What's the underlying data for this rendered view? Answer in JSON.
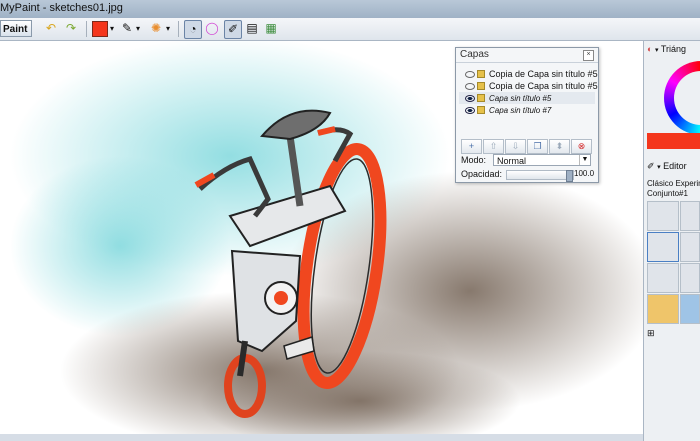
{
  "window": {
    "title": "MyPaint - sketches01.jpg"
  },
  "toolbar": {
    "menu_label": "Paint",
    "colors": {
      "current": "#f4361c",
      "accent": "#e98d2d"
    }
  },
  "layers_panel": {
    "title": "Capas",
    "layers": [
      {
        "name": "Copia de Capa sin título #5",
        "visible": false,
        "italic": false
      },
      {
        "name": "Copia de Capa sin título #5",
        "visible": false,
        "italic": false
      },
      {
        "name": "Capa sin título #5",
        "visible": true,
        "italic": true
      },
      {
        "name": "Capa sin título #7",
        "visible": true,
        "italic": true
      }
    ],
    "buttons": [
      "add-layer-icon",
      "move-up-icon",
      "move-down-icon",
      "duplicate-icon",
      "merge-icon",
      "delete-layer-icon"
    ],
    "mode_label": "Modo:",
    "mode_value": "Normal",
    "opacity_label": "Opacidad:",
    "opacity_value": "100.0"
  },
  "right_panel": {
    "color_title": "Triáng",
    "editor_title": "Editor",
    "brush_set_line1": "Clásico Experim",
    "brush_set_line2": "Conjunto#1",
    "color_swatch": "#f4361c"
  }
}
